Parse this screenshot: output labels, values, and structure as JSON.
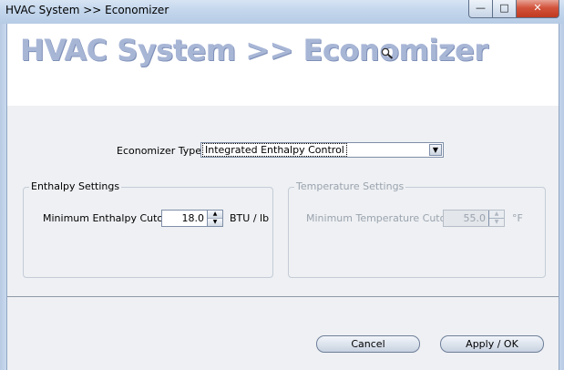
{
  "window": {
    "title": "HVAC System >> Economizer",
    "controls": {
      "minimize": "—",
      "maximize": "□",
      "close": "✕"
    }
  },
  "header": {
    "title": "HVAC System >> Economizer",
    "icon": "magnifier-icon"
  },
  "economizer_type": {
    "label": "Economizer Type",
    "selected": "Integrated Enthalpy Control",
    "dropdown_icon": "▼"
  },
  "enthalpy_settings": {
    "legend": "Enthalpy Settings",
    "min_cutoff_label": "Minimum Enthalpy Cutoff",
    "min_cutoff_value": "18.0",
    "unit": "BTU / lb",
    "enabled": true
  },
  "temperature_settings": {
    "legend": "Temperature Settings",
    "min_cutoff_label": "Minimum Temperature Cutoff",
    "min_cutoff_value": "55.0",
    "unit": "°F",
    "enabled": false
  },
  "footer": {
    "cancel_label": "Cancel",
    "apply_label": "Apply / OK"
  },
  "colors": {
    "title_text": "#a8b6d6",
    "window_frame": "#c3d6ec",
    "close_button": "#c03a20",
    "panel_bg": "#eef0f3"
  }
}
